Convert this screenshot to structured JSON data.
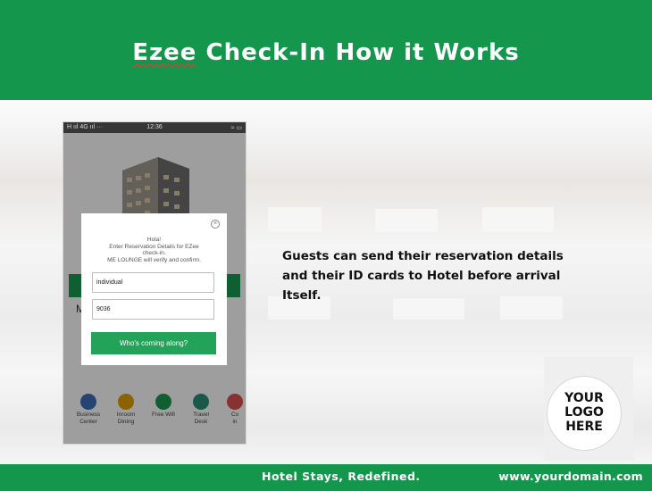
{
  "header": {
    "title_part1": "Ezee",
    "title_part2": " Check-In How it Works"
  },
  "phone": {
    "status_left": "H ııl 4G ııl ···",
    "status_time": "12:36",
    "status_right": "≈ ▭",
    "dialog": {
      "line1": "Hola!",
      "line2": "Enter Reservation Details for EZee",
      "line3": "check-in.",
      "line4": "ME LOUNGE will verify and confirm.",
      "field1_value": "individual",
      "field2_value": "9036",
      "button_label": "Who's coming along?"
    },
    "icons": [
      {
        "label1": "Business",
        "label2": "Center",
        "color": "#3b6fb6"
      },
      {
        "label1": "Inroom",
        "label2": "Dining",
        "color": "#e0a100"
      },
      {
        "label1": "Free Wifi",
        "label2": "",
        "color": "#1a9a53"
      },
      {
        "label1": "Travel",
        "label2": "Desk",
        "color": "#2b8f7a"
      },
      {
        "label1": "Co",
        "label2": "in",
        "color": "#d9534f"
      }
    ],
    "background_letter": "M"
  },
  "description": {
    "line1": "Guests can send their reservation details",
    "line2": "and their ID cards to Hotel before arrival",
    "line3": "Itself."
  },
  "logo": {
    "line1": "YOUR",
    "line2": "LOGO",
    "line3": "HERE"
  },
  "footer": {
    "tagline": "Hotel Stays, Redefined.",
    "domain": "www.yourdomain.com"
  },
  "colors": {
    "brand_green": "#15964d",
    "button_green": "#23a259"
  }
}
